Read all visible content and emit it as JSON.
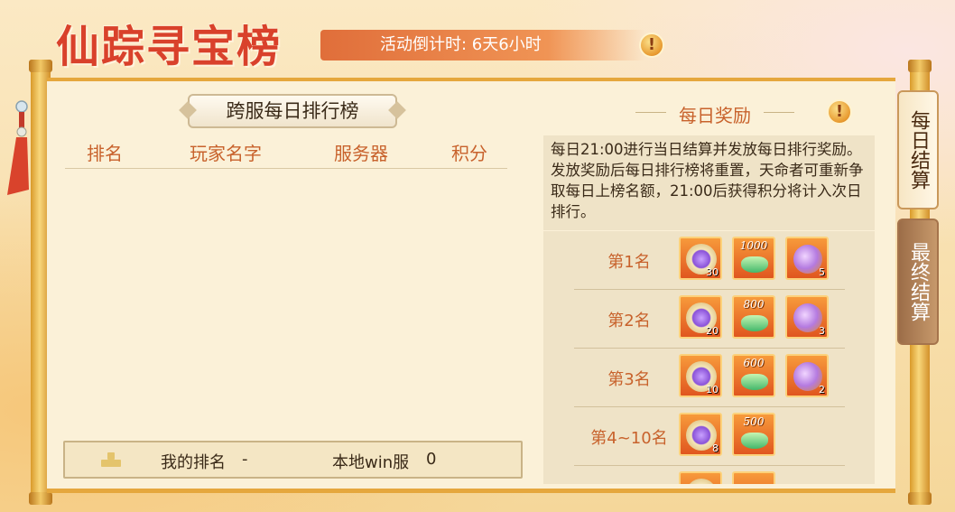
{
  "header": {
    "title": "仙踪寻宝榜",
    "countdown": "活动倒计时: 6天6小时",
    "info_icon": "warning-icon"
  },
  "leaderboard": {
    "title": "跨服每日排行榜",
    "columns": [
      "排名",
      "玩家名字",
      "服务器",
      "积分"
    ],
    "rows": [],
    "my_rank": {
      "label": "我的排名",
      "value": "-",
      "server_label": "本地win服",
      "score": "0"
    }
  },
  "daily_reward": {
    "title": "每日奖励",
    "description": "每日21:00进行当日结算并发放每日排行奖励。发放奖励后每日排行榜将重置，天命者可重新争取每日上榜名额，21:00后获得积分将计入次日排行。",
    "tiers": [
      {
        "rank": "第1名",
        "items": [
          {
            "icon": "purple-flower-coin-icon",
            "count": "30"
          },
          {
            "icon": "green-ingot-icon",
            "label": "1000"
          },
          {
            "icon": "purple-gem-icon",
            "count": "5"
          }
        ]
      },
      {
        "rank": "第2名",
        "items": [
          {
            "icon": "purple-flower-coin-icon",
            "count": "20"
          },
          {
            "icon": "green-ingot-icon",
            "label": "800"
          },
          {
            "icon": "purple-gem-icon",
            "count": "3"
          }
        ]
      },
      {
        "rank": "第3名",
        "items": [
          {
            "icon": "purple-flower-coin-icon",
            "count": "10"
          },
          {
            "icon": "green-ingot-icon",
            "label": "600"
          },
          {
            "icon": "purple-gem-icon",
            "count": "2"
          }
        ]
      },
      {
        "rank": "第4~10名",
        "items": [
          {
            "icon": "purple-flower-coin-icon",
            "count": "8"
          },
          {
            "icon": "green-ingot-icon",
            "label": "500"
          }
        ]
      }
    ]
  },
  "tabs": {
    "daily": "每日结算",
    "final": "最终结算"
  }
}
